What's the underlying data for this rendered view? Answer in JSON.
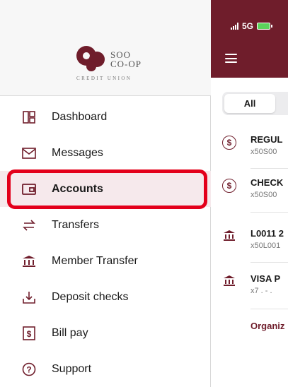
{
  "colors": {
    "brand": "#6f1d2b",
    "active_bg": "#f6e9ec",
    "highlight": "#e3001b"
  },
  "status_bar": {
    "network": "5G"
  },
  "logo": {
    "line1": "SOO",
    "line2": "CO-OP",
    "tagline": "CREDIT UNION"
  },
  "nav": {
    "items": [
      {
        "label": "Dashboard",
        "icon": "dashboard-icon"
      },
      {
        "label": "Messages",
        "icon": "envelope-icon"
      },
      {
        "label": "Accounts",
        "icon": "wallet-icon",
        "active": true
      },
      {
        "label": "Transfers",
        "icon": "transfer-arrows-icon"
      },
      {
        "label": "Member Transfer",
        "icon": "bank-icon"
      },
      {
        "label": "Deposit checks",
        "icon": "download-tray-icon"
      },
      {
        "label": "Bill pay",
        "icon": "dollar-bill-icon"
      },
      {
        "label": "Support",
        "icon": "question-circle-icon"
      }
    ]
  },
  "main": {
    "tabs": [
      {
        "label": "All",
        "selected": true
      }
    ],
    "accounts": [
      {
        "name": "REGUL",
        "number": "x50S00",
        "icon": "dollar-circle-icon"
      },
      {
        "name": "CHECK",
        "number": "x50S00",
        "icon": "dollar-circle-icon"
      },
      {
        "name": "L0011 2",
        "number": "x50L001",
        "icon": "bank-icon"
      },
      {
        "name": "VISA P",
        "number": "x7  . - .",
        "icon": "bank-icon"
      }
    ],
    "organize_label": "Organiz"
  }
}
